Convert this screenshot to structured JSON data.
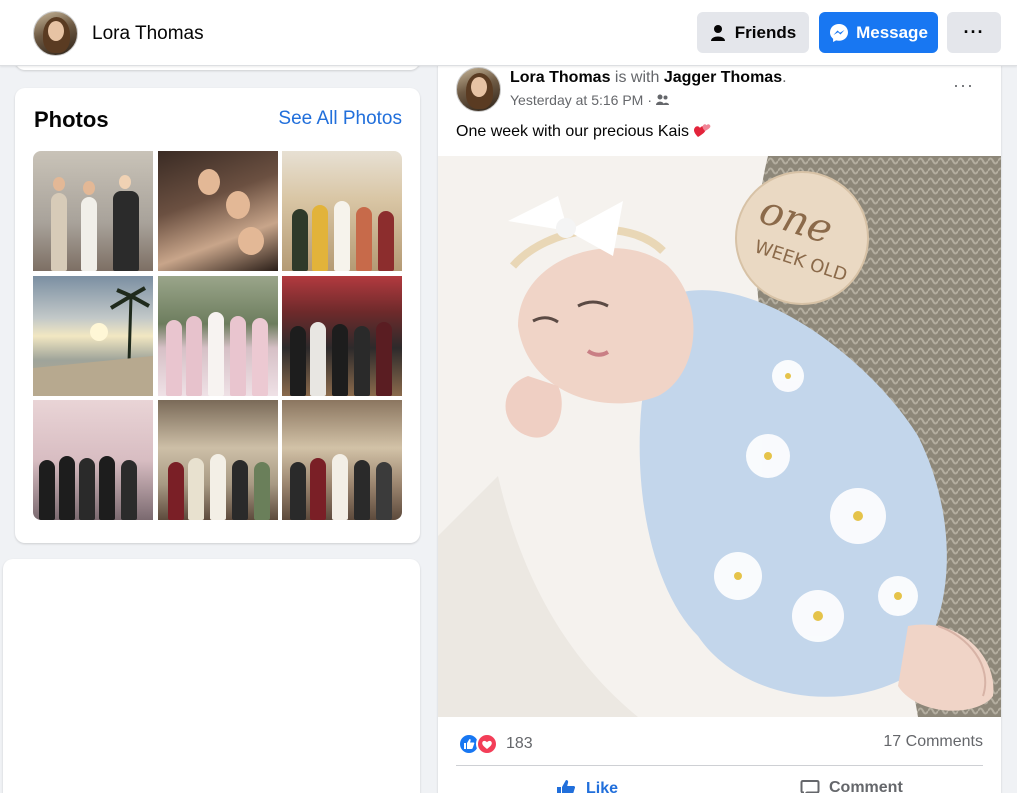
{
  "header": {
    "profile_name": "Lora Thomas",
    "friends_label": "Friends",
    "message_label": "Message",
    "more_label": "···"
  },
  "photos": {
    "title": "Photos",
    "see_all": "See All Photos",
    "count": 9
  },
  "post": {
    "author": "Lora Thomas",
    "with_text": "is with",
    "tagged": "Jagger Thomas",
    "tagged_suffix": ".",
    "timestamp": "Yesterday at 5:16 PM",
    "meta_separator": "·",
    "audience_icon": "friends-icon",
    "options_label": "···",
    "text": "One week with our precious Kais",
    "emoji": "heart-icon",
    "image_sign_line1": "one",
    "image_sign_line2": "WEEK OLD",
    "reaction_count": "183",
    "comments": "17 Comments",
    "like_label": "Like",
    "comment_label": "Comment"
  },
  "colors": {
    "accent": "#1877f2",
    "link": "#216fdb",
    "background": "#f0f2f5",
    "love": "#f33e58"
  }
}
